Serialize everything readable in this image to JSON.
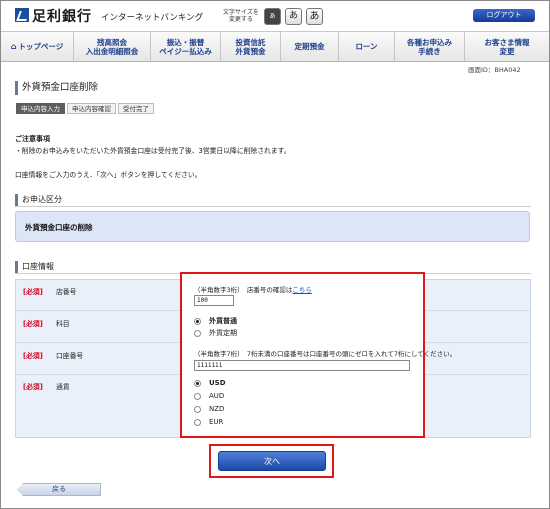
{
  "header": {
    "bank_name": "足利銀行",
    "service_name": "インターネットバンキング",
    "font_size_label_1": "文字サイズを",
    "font_size_label_2": "変更する",
    "font_size_small": "あ",
    "font_size_medium": "あ",
    "font_size_large": "あ",
    "logout_label": "ログアウト"
  },
  "nav": {
    "items": [
      {
        "label": "トップページ"
      },
      {
        "label": "残高照会\n入出金明細照会"
      },
      {
        "label": "振込・振替\nペイジー払込み"
      },
      {
        "label": "投資信託\n外貨預金"
      },
      {
        "label": "定期預金"
      },
      {
        "label": "ローン"
      },
      {
        "label": "各種お申込み\n手続き"
      },
      {
        "label": "お客さま情報\n変更"
      }
    ]
  },
  "screen_id": "画面ID：BHA042",
  "page_title": "外貨預金口座削除",
  "steps": [
    "申込内容入力",
    "申込内容確認",
    "受付完了"
  ],
  "notes": {
    "title": "ご注意事項",
    "body": "・削除のお申込みをいただいた外貨預金口座は受付完了後、3営業日以降に削除されます。"
  },
  "instruction": "口座情報をご入力のうえ、「次へ」ボタンを押してください。",
  "application_section": {
    "title": "お申込区分",
    "value": "外貨預金口座の削除"
  },
  "account_section": {
    "title": "口座情報",
    "required_label": "[必須]",
    "branch": {
      "label": "店番号",
      "hint_prefix": "（半角数字3桁）　店番号の確認は",
      "hint_link": "こちら",
      "value": "100"
    },
    "subject": {
      "label": "科目",
      "options": [
        {
          "label": "外貨普通",
          "checked": true
        },
        {
          "label": "外貨定期",
          "checked": false
        }
      ]
    },
    "account_number": {
      "label": "口座番号",
      "hint": "（半角数字7桁）　7桁未満の口座番号は口座番号の頭にゼロを入れて7桁にしてください。",
      "value": "1111111"
    },
    "currency": {
      "label": "通貨",
      "options": [
        {
          "label": "USD",
          "checked": true
        },
        {
          "label": "AUD",
          "checked": false
        },
        {
          "label": "NZD",
          "checked": false
        },
        {
          "label": "EUR",
          "checked": false
        }
      ]
    }
  },
  "buttons": {
    "next": "次へ",
    "back": "戻る"
  },
  "colors": {
    "brand_blue": "#1d4e9e",
    "highlight_red": "#e01717",
    "panel_blue": "#dce6f7"
  }
}
